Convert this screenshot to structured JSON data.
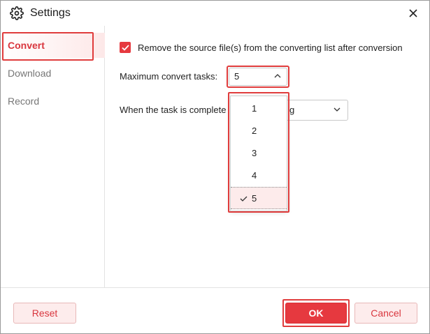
{
  "window": {
    "title": "Settings",
    "title_icon": "gear-icon",
    "close_icon": "close-icon"
  },
  "sidebar": {
    "items": [
      {
        "label": "Convert",
        "active": true
      },
      {
        "label": "Download",
        "active": false
      },
      {
        "label": "Record",
        "active": false
      }
    ]
  },
  "convert": {
    "remove_source": {
      "checked": true,
      "label": "Remove the source file(s) from the converting list after conversion"
    },
    "max_tasks": {
      "label": "Maximum convert tasks:",
      "value": "5",
      "options": [
        "1",
        "2",
        "3",
        "4",
        "5"
      ],
      "selected": "5",
      "open": true
    },
    "on_complete": {
      "label": "When the task is complete",
      "value_visible": "g"
    }
  },
  "footer": {
    "reset_label": "Reset",
    "ok_label": "OK",
    "cancel_label": "Cancel"
  },
  "colors": {
    "accent": "#e6393f",
    "highlight": "#e03c3c",
    "selected_bg": "#fdebeb"
  }
}
